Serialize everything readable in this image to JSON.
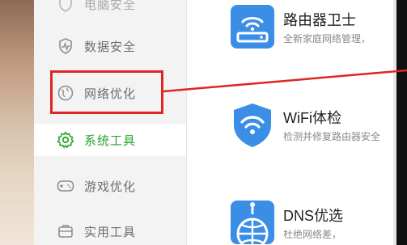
{
  "sidebar": {
    "items": [
      {
        "label": "电脑安全",
        "icon": "shield-icon",
        "active": false,
        "faded": true
      },
      {
        "label": "数据安全",
        "icon": "pulse-shield-icon",
        "active": false,
        "faded": false
      },
      {
        "label": "网络优化",
        "icon": "globe-icon",
        "active": false,
        "faded": false
      },
      {
        "label": "系统工具",
        "icon": "gear-icon",
        "active": true,
        "faded": false
      },
      {
        "label": "游戏优化",
        "icon": "gamepad-icon",
        "active": false,
        "faded": false
      },
      {
        "label": "实用工具",
        "icon": "toolbox-icon",
        "active": false,
        "faded": false
      }
    ]
  },
  "tools": [
    {
      "title": "路由器卫士",
      "desc": "全新家庭网络管理，",
      "icon": "router-icon"
    },
    {
      "title": "WiFi体检",
      "desc": "检测并修复路由器安全",
      "icon": "wifi-shield-icon"
    },
    {
      "title": "DNS优选",
      "desc": "杜绝网络差，",
      "icon": "dns-globe-icon"
    }
  ],
  "colors": {
    "accent_green": "#2aa32a",
    "icon_blue": "#3a8ee6",
    "highlight_red": "#e02424"
  }
}
